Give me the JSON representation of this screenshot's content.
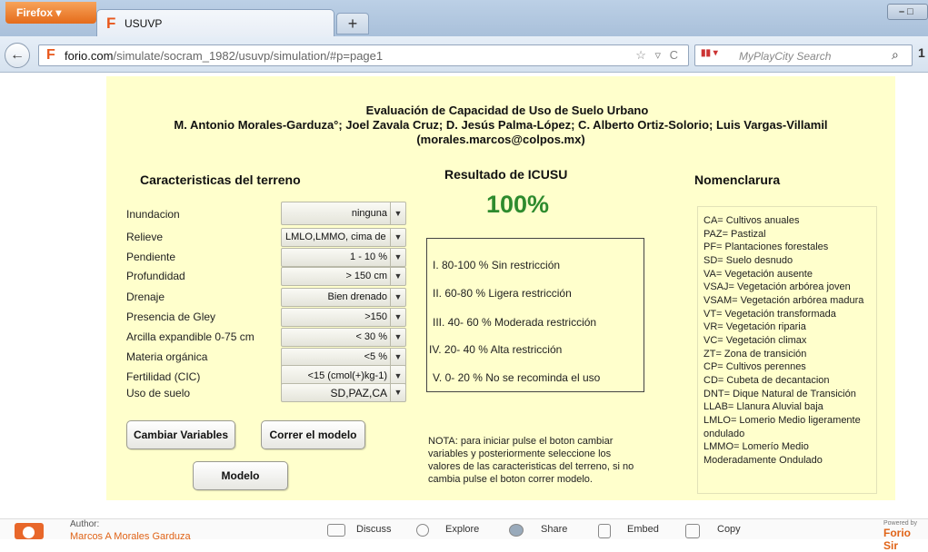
{
  "browser": {
    "menu_button": "Firefox ▾",
    "tab_title": "USUVP",
    "new_tab": "+",
    "url_domain": "forio.com",
    "url_path": "/simulate/socram_1982/usuvp/simulation/#p=page1",
    "url_icons": "☆ ▿ C",
    "search_placeholder": "MyPlayCity Search",
    "back": "←",
    "window_controls": "– □"
  },
  "panel": {
    "title_line1": "Evaluación de  Capacidad de Uso de Suelo Urbano",
    "title_line2": "M. Antonio Morales-Garduza°; Joel Zavala Cruz; D. Jesús Palma-López; C. Alberto Ortiz-Solorio;  Luis Vargas-Villamil",
    "title_line3": "(morales.marcos@colpos.mx)",
    "terrain_heading": "Caracteristicas del terreno",
    "result_heading": "Resultado de ICUSU",
    "nomenclature_heading": "Nomenclarura",
    "result_value": "100%",
    "variables": [
      {
        "label": "Inundacion",
        "value": "ninguna"
      },
      {
        "label": "Relieve",
        "value": "LMLO,LMMO, cima de"
      },
      {
        "label": "Pendiente",
        "value": "1 - 10 %"
      },
      {
        "label": "Profundidad",
        "value": "> 150 cm"
      },
      {
        "label": "Drenaje",
        "value": "Bien drenado"
      },
      {
        "label": "Presencia de Gley",
        "value": ">150"
      },
      {
        "label": "Arcilla expandible 0-75 cm",
        "value": "< 30 %"
      },
      {
        "label": "Materia orgánica",
        "value": "<5 %"
      },
      {
        "label": "Fertilidad (CIC)",
        "value": "<15 (cmol(+)kg-1)"
      },
      {
        "label": "Uso de suelo",
        "value": "SD,PAZ,CA"
      }
    ],
    "dropdown_arrow": "▼",
    "buttons": {
      "change_variables": "Cambiar Variables",
      "run_model": "Correr el modelo",
      "model": "Modelo"
    },
    "legend": [
      "I.  80-100 %  Sin restricción",
      "II.  60-80 %    Ligera restricción",
      "III.  40- 60 %   Moderada restricción",
      "IV.  20- 40 %   Alta restricción",
      "V.  0- 20 %     No se recominda el uso"
    ],
    "note": "NOTA: para iniciar pulse el boton  cambiar variables y posteriormente seleccione los valores de las caracteristicas del terreno, si no cambia pulse el boton correr modelo.",
    "nomenclature": [
      "CA= Cultivos anuales",
      "PAZ= Pastizal",
      "PF= Plantaciones forestales",
      "SD= Suelo desnudo",
      "VA= Vegetación ausente",
      "VSAJ= Vegetación arbórea joven",
      "VSAM= Vegetación arbórea madura",
      "VT= Vegetación transformada",
      "VR= Vegetación riparia",
      "VC= Vegetación climax",
      "ZT= Zona de transición",
      "CP= Cultivos perennes",
      "CD= Cubeta de decantacion",
      "DNT= Dique Natural de Transición",
      "LLAB= Llanura Aluvial baja",
      "LMLO= Lomerio Medio ligeramente ondulado",
      "LMMO= Lomerío Medio Moderadamente Ondulado"
    ]
  },
  "footer": {
    "author_label": "Author:",
    "author_name": "Marcos A Morales Garduza",
    "discuss": "Discuss",
    "explore": "Explore",
    "share": "Share",
    "embed": "Embed",
    "copy": "Copy",
    "powered_by": "Powered by",
    "brand": "Forio Sir"
  },
  "colors": {
    "panel_bg": "#ffffcc",
    "result_green": "#2e8b2e",
    "brand_orange": "#e06418"
  }
}
